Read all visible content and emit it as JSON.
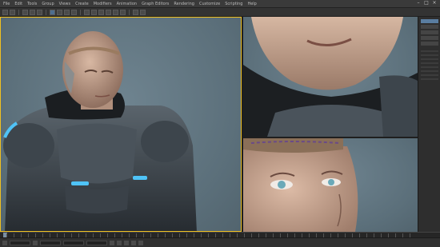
{
  "menubar": {
    "items": [
      "File",
      "Edit",
      "Tools",
      "Group",
      "Views",
      "Create",
      "Modifiers",
      "Animation",
      "Graph Editors",
      "Rendering",
      "Customize",
      "Scripting",
      "Help"
    ]
  },
  "colors": {
    "viewport_bg": "#5b6f7a",
    "active_border": "#f0c020",
    "armor": "#3a4148",
    "armor_glow": "#4fc3f7",
    "skin": "#c9a893",
    "ui_bg": "#2b2b2b"
  },
  "icons": [
    "undo-icon",
    "redo-icon",
    "link-icon",
    "unlink-icon",
    "bind-icon",
    "select-icon",
    "move-icon",
    "rotate-icon",
    "scale-icon",
    "snap-icon",
    "mirror-icon",
    "align-icon",
    "layer-icon",
    "curve-icon",
    "material-icon",
    "render-setup-icon",
    "render-icon"
  ]
}
